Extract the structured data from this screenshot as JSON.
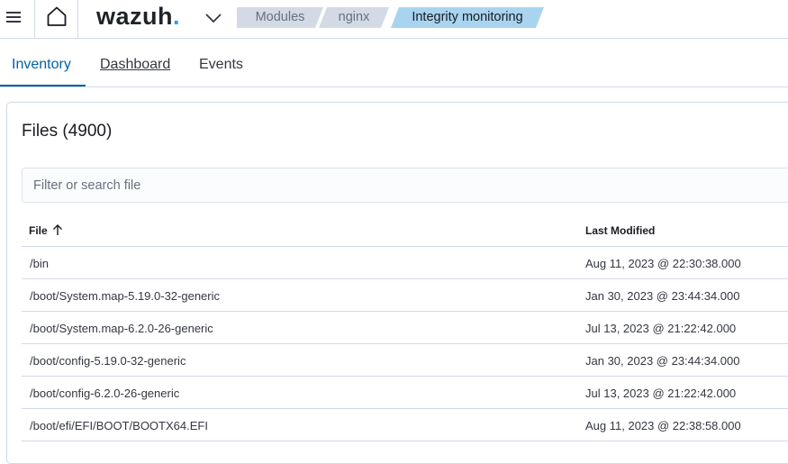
{
  "header": {
    "logo_text": "wazuh",
    "logo_dot": ".",
    "breadcrumbs": [
      {
        "label": "Modules"
      },
      {
        "label": "nginx"
      },
      {
        "label": "Integrity monitoring"
      }
    ]
  },
  "tabs": [
    {
      "label": "Inventory"
    },
    {
      "label": "Dashboard"
    },
    {
      "label": "Events"
    }
  ],
  "panel": {
    "title": "Files (4900)",
    "search_placeholder": "Filter or search file"
  },
  "table": {
    "columns": [
      "File",
      "Last Modified"
    ],
    "rows": [
      {
        "file": "/bin",
        "modified": "Aug 11, 2023 @ 22:30:38.000"
      },
      {
        "file": "/boot/System.map-5.19.0-32-generic",
        "modified": "Jan 30, 2023 @ 23:44:34.000"
      },
      {
        "file": "/boot/System.map-6.2.0-26-generic",
        "modified": "Jul 13, 2023 @ 21:22:42.000"
      },
      {
        "file": "/boot/config-5.19.0-32-generic",
        "modified": "Jan 30, 2023 @ 23:44:34.000"
      },
      {
        "file": "/boot/config-6.2.0-26-generic",
        "modified": "Jul 13, 2023 @ 21:22:42.000"
      },
      {
        "file": "/boot/efi/EFI/BOOT/BOOTX64.EFI",
        "modified": "Aug 11, 2023 @ 22:38:58.000"
      }
    ]
  },
  "colors": {
    "accent": "#0061a6",
    "breadcrumb_active_bg": "#a8d4f0",
    "breadcrumb_bg": "#d3dae6",
    "logo_dot": "#3595f9"
  },
  "icons": [
    "menu-icon",
    "home-icon",
    "chevron-down-icon",
    "sort-ascending-icon"
  ]
}
